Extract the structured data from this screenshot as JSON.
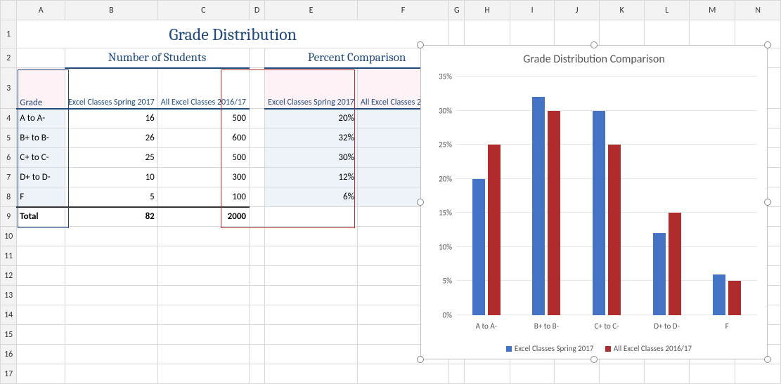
{
  "columns": [
    "A",
    "B",
    "C",
    "D",
    "E",
    "F",
    "G",
    "H",
    "I",
    "J",
    "K",
    "L",
    "M",
    "N"
  ],
  "rows": [
    "1",
    "2",
    "3",
    "4",
    "5",
    "6",
    "7",
    "8",
    "9",
    "10",
    "11",
    "12",
    "13",
    "14",
    "15",
    "16",
    "17"
  ],
  "title": "Grade Distribution",
  "sections": {
    "students": "Number of Students",
    "percent": "Percent Comparison"
  },
  "headers": {
    "grade": "Grade",
    "spring": "Excel Classes Spring 2017",
    "all": "All Excel Classes 2016/17"
  },
  "grades": [
    "A to A-",
    "B+ to B-",
    "C+ to C-",
    "D+ to D-",
    "F"
  ],
  "counts": {
    "spring": [
      16,
      26,
      25,
      10,
      5
    ],
    "all": [
      500,
      600,
      500,
      300,
      100
    ]
  },
  "percent": {
    "spring": [
      "20%",
      "32%",
      "30%",
      "12%",
      "6%"
    ],
    "all": [
      "25%",
      "30%",
      "25%",
      "15%",
      "5%"
    ]
  },
  "totals": {
    "label": "Total",
    "spring": 82,
    "all": 2000
  },
  "chart_data": {
    "type": "bar",
    "title": "Grade Distribution Comparison",
    "categories": [
      "A to A-",
      "B+ to B-",
      "C+ to C-",
      "D+ to D-",
      "F"
    ],
    "series": [
      {
        "name": "Excel Classes Spring 2017",
        "values": [
          20,
          32,
          30,
          12,
          6
        ],
        "color": "#4472c4"
      },
      {
        "name": "All Excel Classes 2016/17",
        "values": [
          25,
          30,
          25,
          15,
          5
        ],
        "color": "#b02b2b"
      }
    ],
    "ylabel": "",
    "xlabel": "",
    "ylim": [
      0,
      35
    ],
    "yticks": [
      0,
      5,
      10,
      15,
      20,
      25,
      30,
      35
    ],
    "ytick_labels": [
      "0%",
      "5%",
      "10%",
      "15%",
      "20%",
      "25%",
      "30%",
      "35%"
    ]
  }
}
